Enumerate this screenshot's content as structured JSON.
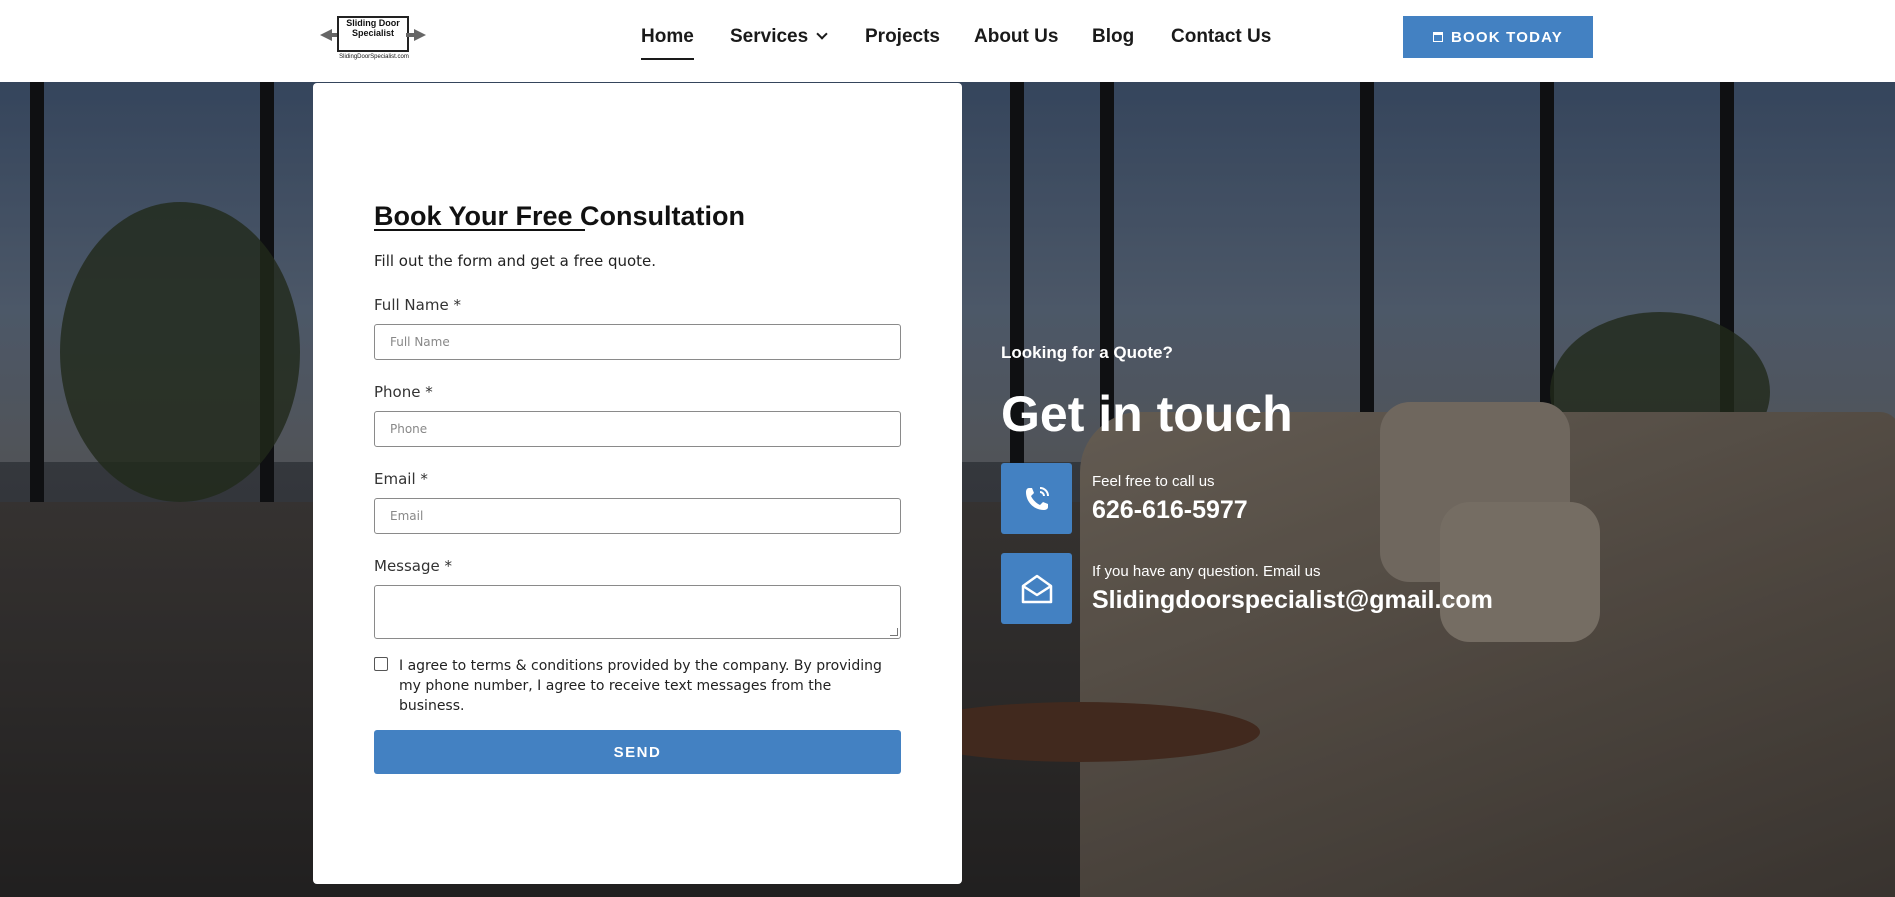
{
  "header": {
    "logo": {
      "text": "Sliding Door Specialist",
      "url": "SlidingDoorSpecialist.com"
    },
    "nav": [
      {
        "label": "Home",
        "active": true
      },
      {
        "label": "Services",
        "has_dropdown": true
      },
      {
        "label": "Projects"
      },
      {
        "label": "About Us"
      },
      {
        "label": "Blog"
      },
      {
        "label": "Contact Us"
      }
    ],
    "cta_label": "BOOK TODAY",
    "cta_icon": "calendar-icon"
  },
  "form": {
    "title": "Book Your Free Consultation",
    "subtitle": "Fill out the form and get a free quote.",
    "fields": [
      {
        "label": "Full Name *",
        "placeholder": "Full Name",
        "value": ""
      },
      {
        "label": "Phone *",
        "placeholder": "Phone",
        "value": ""
      },
      {
        "label": "Email *",
        "placeholder": "Email",
        "value": ""
      },
      {
        "label": "Message *",
        "placeholder": "",
        "value": ""
      }
    ],
    "terms": "I agree to terms & conditions provided by the company. By providing my phone number, I agree to receive text messages from the business.",
    "terms_checked": false,
    "submit_label": "SEND"
  },
  "contact": {
    "kicker": "Looking for a Quote?",
    "title": "Get in touch",
    "items": [
      {
        "caption": "Feel free to call us",
        "value": "626-616-5977",
        "icon": "phone-icon"
      },
      {
        "caption": "If you have any question. Email us",
        "value": "Slidingdoorspecialist@gmail.com",
        "icon": "envelope-open-icon"
      }
    ]
  },
  "colors": {
    "accent": "#4381c2",
    "text_dark": "#1a1a1a",
    "white": "#ffffff"
  }
}
